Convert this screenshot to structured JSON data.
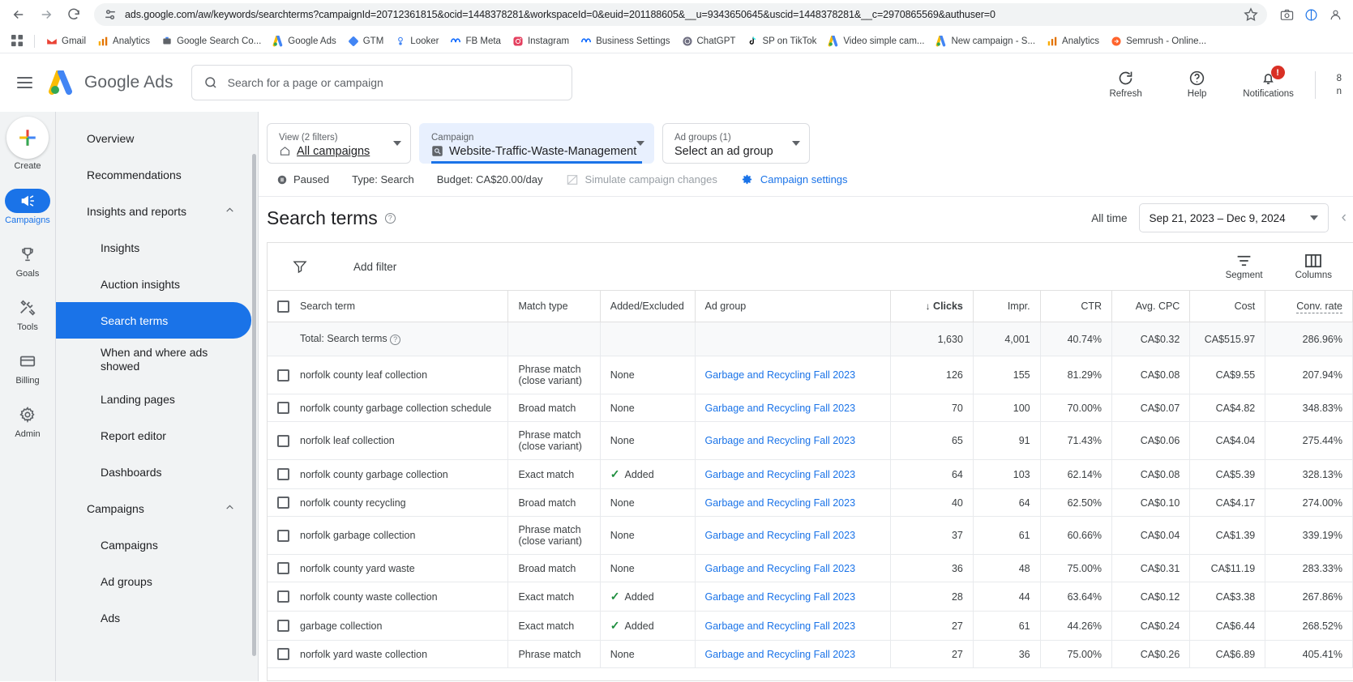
{
  "browser": {
    "url": "ads.google.com/aw/keywords/searchterms?campaignId=20712361815&ocid=1448378281&workspaceId=0&euid=201188605&__u=9343650645&uscid=1448378281&__c=2970865569&authuser=0",
    "bookmarks": [
      {
        "label": "Gmail",
        "icon": "gmail-icon"
      },
      {
        "label": "Analytics",
        "icon": "analytics-icon"
      },
      {
        "label": "Google Search Co...",
        "icon": "search-console-icon"
      },
      {
        "label": "Google Ads",
        "icon": "google-ads-icon"
      },
      {
        "label": "GTM",
        "icon": "gtm-icon"
      },
      {
        "label": "Looker",
        "icon": "looker-icon"
      },
      {
        "label": "FB Meta",
        "icon": "meta-icon"
      },
      {
        "label": "Instagram",
        "icon": "instagram-icon"
      },
      {
        "label": "Business Settings",
        "icon": "meta-icon"
      },
      {
        "label": "ChatGPT",
        "icon": "chatgpt-icon"
      },
      {
        "label": "SP on TikTok",
        "icon": "tiktok-icon"
      },
      {
        "label": "Video simple cam...",
        "icon": "google-ads-icon"
      },
      {
        "label": "New campaign - S...",
        "icon": "google-ads-icon"
      },
      {
        "label": "Analytics",
        "icon": "analytics-icon"
      },
      {
        "label": "Semrush - Online...",
        "icon": "semrush-icon"
      }
    ]
  },
  "header": {
    "brand_google": "Google",
    "brand_ads": "Ads",
    "search_placeholder": "Search for a page or campaign",
    "actions": [
      {
        "label": "Refresh",
        "icon": "refresh-icon"
      },
      {
        "label": "Help",
        "icon": "help-icon"
      },
      {
        "label": "Notifications",
        "icon": "bell-icon",
        "badge": "!"
      }
    ],
    "account_line1": "8",
    "account_line2": "n"
  },
  "rail": {
    "create_label": "Create",
    "items": [
      {
        "label": "Campaigns",
        "icon": "megaphone-icon",
        "active": true
      },
      {
        "label": "Goals",
        "icon": "trophy-icon",
        "active": false
      },
      {
        "label": "Tools",
        "icon": "tools-icon",
        "active": false
      },
      {
        "label": "Billing",
        "icon": "billing-icon",
        "active": false
      },
      {
        "label": "Admin",
        "icon": "gear-icon",
        "active": false
      }
    ]
  },
  "nav": {
    "items": [
      {
        "label": "Overview",
        "level": 0,
        "active": false
      },
      {
        "label": "Recommendations",
        "level": 0,
        "active": false
      },
      {
        "label": "Insights and reports",
        "level": 0,
        "active": false,
        "expander": "chevron-up-icon"
      },
      {
        "label": "Insights",
        "level": 1,
        "active": false
      },
      {
        "label": "Auction insights",
        "level": 1,
        "active": false
      },
      {
        "label": "Search terms",
        "level": 1,
        "active": true
      },
      {
        "label": "When and where ads showed",
        "level": 1,
        "active": false,
        "two_line": true
      },
      {
        "label": "Landing pages",
        "level": 1,
        "active": false
      },
      {
        "label": "Report editor",
        "level": 1,
        "active": false
      },
      {
        "label": "Dashboards",
        "level": 1,
        "active": false
      },
      {
        "label": "Campaigns",
        "level": 0,
        "active": false,
        "expander": "chevron-up-icon"
      },
      {
        "label": "Campaigns",
        "level": 1,
        "active": false
      },
      {
        "label": "Ad groups",
        "level": 1,
        "active": false
      },
      {
        "label": "Ads",
        "level": 1,
        "active": false
      }
    ]
  },
  "selectors": {
    "view": {
      "caption": "View (2 filters)",
      "value": "All campaigns"
    },
    "campaign": {
      "caption": "Campaign",
      "value": "Website-Traffic-Waste-Management"
    },
    "adgroups": {
      "caption": "Ad groups (1)",
      "value": "Select an ad group"
    }
  },
  "campaign_meta": {
    "status": "Paused",
    "type": "Type: Search",
    "budget": "Budget: CA$20.00/day",
    "simulate": "Simulate campaign changes",
    "settings": "Campaign settings"
  },
  "page": {
    "title": "Search terms",
    "all_time_label": "All time",
    "date_range": "Sep 21, 2023 – Dec 9, 2024"
  },
  "toolbar": {
    "add_filter": "Add filter",
    "segment": "Segment",
    "columns": "Columns"
  },
  "table": {
    "columns": [
      {
        "label": "Search term",
        "align": "left"
      },
      {
        "label": "Match type",
        "align": "left"
      },
      {
        "label": "Added/Excluded",
        "align": "left"
      },
      {
        "label": "Ad group",
        "align": "left"
      },
      {
        "label": "Clicks",
        "align": "right",
        "sorted": true
      },
      {
        "label": "Impr.",
        "align": "right"
      },
      {
        "label": "CTR",
        "align": "right"
      },
      {
        "label": "Avg. CPC",
        "align": "right"
      },
      {
        "label": "Cost",
        "align": "right"
      },
      {
        "label": "Conv. rate",
        "align": "right"
      }
    ],
    "total_row": {
      "label": "Total: Search terms",
      "clicks": "1,630",
      "impr": "4,001",
      "ctr": "40.74%",
      "avg_cpc": "CA$0.32",
      "cost": "CA$515.97",
      "conv_rate": "286.96%"
    },
    "rows": [
      {
        "term": "norfolk county leaf collection",
        "match": "Phrase match (close variant)",
        "added": "None",
        "adgroup": "Garbage and Recycling Fall 2023",
        "clicks": "126",
        "impr": "155",
        "ctr": "81.29%",
        "avg_cpc": "CA$0.08",
        "cost": "CA$9.55",
        "conv_rate": "207.94%"
      },
      {
        "term": "norfolk county garbage collection schedule",
        "match": "Broad match",
        "added": "None",
        "adgroup": "Garbage and Recycling Fall 2023",
        "clicks": "70",
        "impr": "100",
        "ctr": "70.00%",
        "avg_cpc": "CA$0.07",
        "cost": "CA$4.82",
        "conv_rate": "348.83%"
      },
      {
        "term": "norfolk leaf collection",
        "match": "Phrase match (close variant)",
        "added": "None",
        "adgroup": "Garbage and Recycling Fall 2023",
        "clicks": "65",
        "impr": "91",
        "ctr": "71.43%",
        "avg_cpc": "CA$0.06",
        "cost": "CA$4.04",
        "conv_rate": "275.44%"
      },
      {
        "term": "norfolk county garbage collection",
        "match": "Exact match",
        "added": "Added",
        "adgroup": "Garbage and Recycling Fall 2023",
        "clicks": "64",
        "impr": "103",
        "ctr": "62.14%",
        "avg_cpc": "CA$0.08",
        "cost": "CA$5.39",
        "conv_rate": "328.13%"
      },
      {
        "term": "norfolk county recycling",
        "match": "Broad match",
        "added": "None",
        "adgroup": "Garbage and Recycling Fall 2023",
        "clicks": "40",
        "impr": "64",
        "ctr": "62.50%",
        "avg_cpc": "CA$0.10",
        "cost": "CA$4.17",
        "conv_rate": "274.00%"
      },
      {
        "term": "norfolk garbage collection",
        "match": "Phrase match (close variant)",
        "added": "None",
        "adgroup": "Garbage and Recycling Fall 2023",
        "clicks": "37",
        "impr": "61",
        "ctr": "60.66%",
        "avg_cpc": "CA$0.04",
        "cost": "CA$1.39",
        "conv_rate": "339.19%"
      },
      {
        "term": "norfolk county yard waste",
        "match": "Broad match",
        "added": "None",
        "adgroup": "Garbage and Recycling Fall 2023",
        "clicks": "36",
        "impr": "48",
        "ctr": "75.00%",
        "avg_cpc": "CA$0.31",
        "cost": "CA$11.19",
        "conv_rate": "283.33%"
      },
      {
        "term": "norfolk county waste collection",
        "match": "Exact match",
        "added": "Added",
        "adgroup": "Garbage and Recycling Fall 2023",
        "clicks": "28",
        "impr": "44",
        "ctr": "63.64%",
        "avg_cpc": "CA$0.12",
        "cost": "CA$3.38",
        "conv_rate": "267.86%"
      },
      {
        "term": "garbage collection",
        "match": "Exact match",
        "added": "Added",
        "adgroup": "Garbage and Recycling Fall 2023",
        "clicks": "27",
        "impr": "61",
        "ctr": "44.26%",
        "avg_cpc": "CA$0.24",
        "cost": "CA$6.44",
        "conv_rate": "268.52%"
      },
      {
        "term": "norfolk yard waste collection",
        "match": "Phrase match",
        "added": "None",
        "adgroup": "Garbage and Recycling Fall 2023",
        "clicks": "27",
        "impr": "36",
        "ctr": "75.00%",
        "avg_cpc": "CA$0.26",
        "cost": "CA$6.89",
        "conv_rate": "405.41%"
      }
    ]
  },
  "colors": {
    "accent": "#1a73e8",
    "added_green": "#1e8e3e",
    "badge_red": "#d93025",
    "rail_bg": "#f1f3f4"
  }
}
